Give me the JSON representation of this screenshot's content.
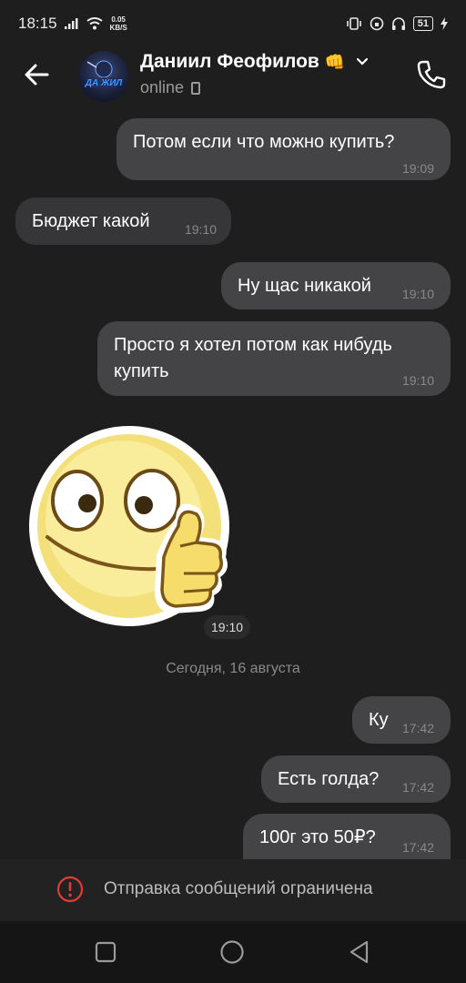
{
  "status_bar": {
    "time": "18:15",
    "net_speed_value": "0.05",
    "net_speed_unit": "KB/S",
    "battery": "51"
  },
  "header": {
    "contact_name": "Даниил Феофилов",
    "contact_emoji": "👊",
    "status": "online",
    "avatar_text": "ДА ЖИЛ"
  },
  "messages": [
    {
      "text": "Потом если что можно купить?",
      "time": "19:09",
      "direction": "out"
    },
    {
      "text": "Бюджет какой",
      "time": "19:10",
      "direction": "in"
    },
    {
      "text": "Ну щас никакой",
      "time": "19:10",
      "direction": "out"
    },
    {
      "text": "Просто я хотел потом как нибудь купить",
      "time": "19:10",
      "direction": "out"
    },
    {
      "text": "",
      "time": "19:10",
      "direction": "in",
      "kind": "sticker",
      "sticker": "thumbs-up-smiley"
    },
    {
      "text": "Ку",
      "time": "17:42",
      "direction": "out"
    },
    {
      "text": "Есть голда?",
      "time": "17:42",
      "direction": "out"
    },
    {
      "text": "100г это 50₽?",
      "time": "17:42",
      "direction": "out"
    }
  ],
  "date_separator": "Сегодня, 16 августа",
  "restriction_banner": {
    "text": "Отправка сообщений ограничена",
    "icon": "exclamation-circle-icon"
  },
  "colors": {
    "background": "#1e1e1e",
    "bubble_out": "#444446",
    "bubble_in": "#363638",
    "warning": "#e53935"
  },
  "icons": [
    "back-arrow-icon",
    "chevron-down-icon",
    "phone-call-icon",
    "mobile-device-icon",
    "square-nav-icon",
    "circle-nav-icon",
    "triangle-back-nav-icon"
  ]
}
